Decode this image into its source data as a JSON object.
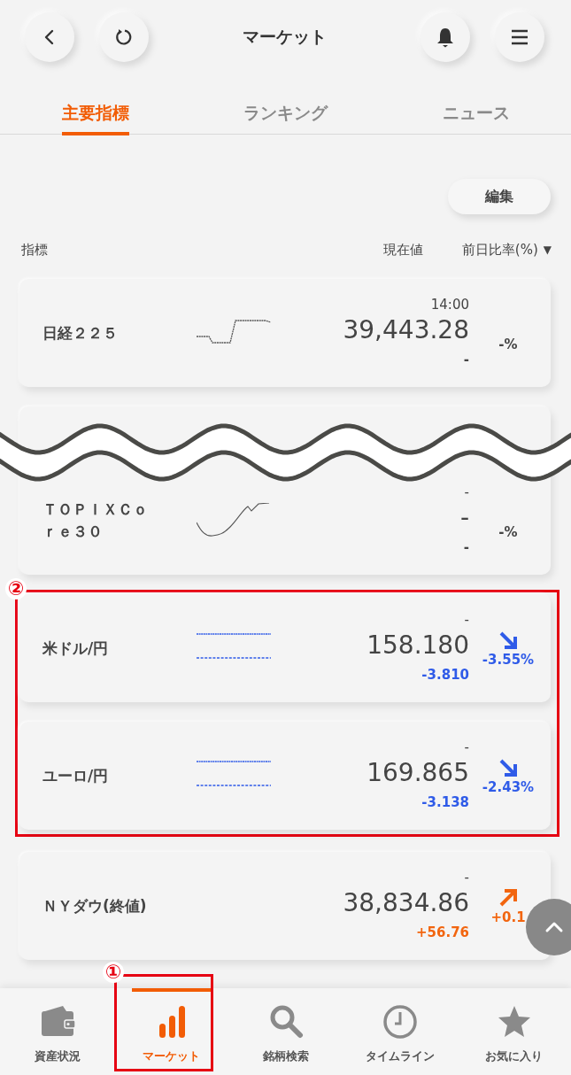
{
  "header": {
    "title": "マーケット"
  },
  "tabs": [
    {
      "label": "主要指標",
      "selected": true
    },
    {
      "label": "ランキング",
      "selected": false
    },
    {
      "label": "ニュース",
      "selected": false
    }
  ],
  "edit_button": "編集",
  "columns": {
    "name": "指標",
    "value": "現在値",
    "change": "前日比率(%)",
    "sort_mark": "▼"
  },
  "sections": [
    {
      "rows": [
        {
          "name": "日経２２５",
          "kind": "step",
          "time": "14:00",
          "value": "39,443.28",
          "change": "-",
          "color": "#454545",
          "percent": "-%",
          "cut_above": false
        },
        {
          "name": "ＴＯＰＩＸＣｏｒｅ３０",
          "kind": "rise",
          "time": "-",
          "value": "-",
          "change": "-",
          "color": "#454545",
          "percent": "-%",
          "cut_above": true
        }
      ]
    },
    {
      "callout": "②",
      "rows": [
        {
          "name": "米ドル/円",
          "kind": "bands_down",
          "time": "-",
          "value": "158.180",
          "change": "-3.810",
          "color": "#2f5be8",
          "percent": "-3.55%",
          "cut_above": false
        },
        {
          "name": "ユーロ/円",
          "kind": "bands_down",
          "time": "-",
          "value": "169.865",
          "change": "-3.138",
          "color": "#2f5be8",
          "percent": "-2.43%",
          "cut_above": false
        }
      ]
    },
    {
      "rows": [
        {
          "name": "ＮＹダウ(終値)",
          "kind": "plain_up",
          "time": "-",
          "value": "38,834.86",
          "change": "+56.76",
          "color": "#f2650f",
          "percent": "+0.1",
          "cut_above": false
        }
      ]
    }
  ],
  "nav": [
    {
      "label": "資産状況",
      "kind": "wallet",
      "selected": false
    },
    {
      "label": "マーケット",
      "kind": "bars",
      "selected": true,
      "callout": "①"
    },
    {
      "label": "銘柄検索",
      "kind": "search",
      "selected": false
    },
    {
      "label": "タイムライン",
      "kind": "clock",
      "selected": false
    },
    {
      "label": "お気に入り",
      "kind": "star",
      "selected": false
    }
  ]
}
